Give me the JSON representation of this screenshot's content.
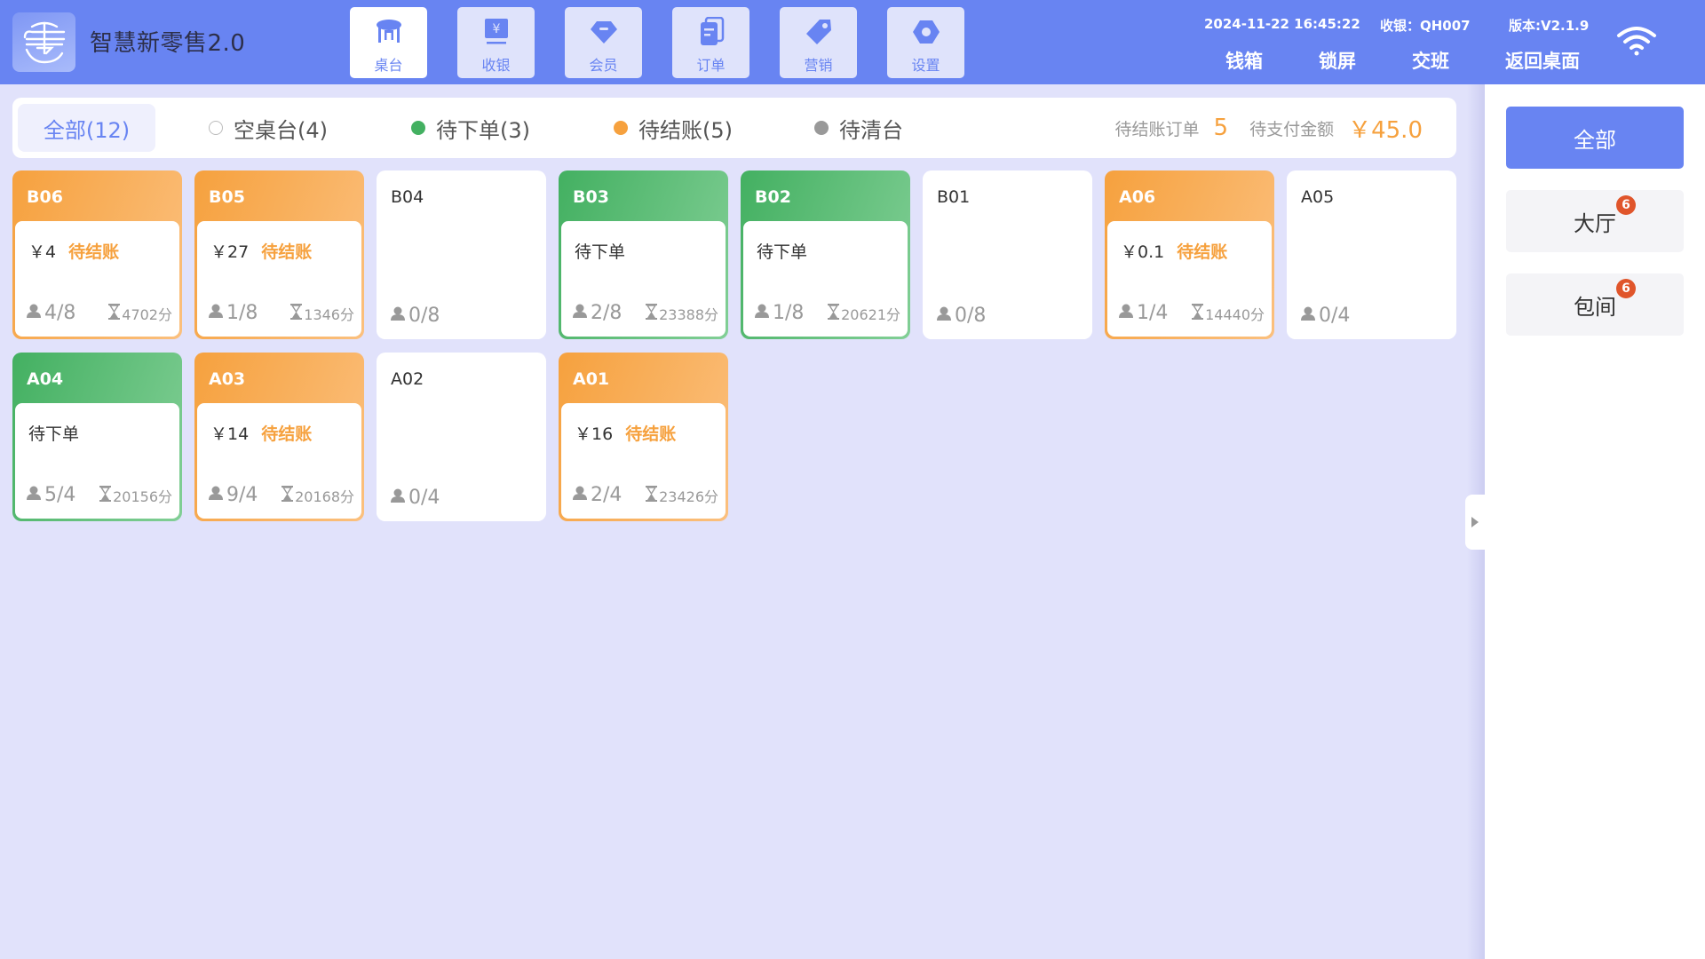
{
  "header": {
    "app_title": "智慧新零售2.0",
    "logo_icon": "store-logo-icon",
    "nav": [
      {
        "label": "桌台",
        "icon": "table-icon",
        "active": true
      },
      {
        "label": "收银",
        "icon": "cashier-icon",
        "active": false
      },
      {
        "label": "会员",
        "icon": "diamond-icon",
        "active": false
      },
      {
        "label": "订单",
        "icon": "order-icon",
        "active": false
      },
      {
        "label": "营销",
        "icon": "tag-icon",
        "active": false
      },
      {
        "label": "设置",
        "icon": "settings-icon",
        "active": false
      }
    ],
    "datetime": "2024-11-22 16:45:22",
    "cashier": "收银：QH007",
    "version": "版本:V2.1.9",
    "actions": [
      "钱箱",
      "锁屏",
      "交班",
      "返回桌面"
    ],
    "wifi_icon": "wifi-icon"
  },
  "filters": [
    {
      "label": "全部(12)",
      "active": true
    },
    {
      "label": "空桌台(4)",
      "dot_color": "#ffffff"
    },
    {
      "label": "待下单(3)",
      "dot_color": "#43b061"
    },
    {
      "label": "待结账(5)",
      "dot_color": "#f6a13e"
    },
    {
      "label": "待清台",
      "dot_color": "#999999"
    }
  ],
  "summary": {
    "pending_orders_label": "待结账订单",
    "pending_orders_value": "5",
    "pending_amount_label": "待支付金额",
    "pending_amount_value": "￥45.0"
  },
  "tables": [
    {
      "name": "B06",
      "status": "checkout",
      "amount": "￥4",
      "status_label": "待结账",
      "guests": "4/8",
      "time": "4702分"
    },
    {
      "name": "B05",
      "status": "checkout",
      "amount": "￥27",
      "status_label": "待结账",
      "guests": "1/8",
      "time": "1346分"
    },
    {
      "name": "B04",
      "status": "idle",
      "guests": "0/8"
    },
    {
      "name": "B03",
      "status": "order",
      "status_label": "待下单",
      "guests": "2/8",
      "time": "23388分"
    },
    {
      "name": "B02",
      "status": "order",
      "status_label": "待下单",
      "guests": "1/8",
      "time": "20621分"
    },
    {
      "name": "B01",
      "status": "idle",
      "guests": "0/8"
    },
    {
      "name": "A06",
      "status": "checkout",
      "amount": "￥0.1",
      "status_label": "待结账",
      "guests": "1/4",
      "time": "14440分"
    },
    {
      "name": "A05",
      "status": "idle",
      "guests": "0/4"
    },
    {
      "name": "A04",
      "status": "order",
      "status_label": "待下单",
      "guests": "5/4",
      "time": "20156分"
    },
    {
      "name": "A03",
      "status": "checkout",
      "amount": "￥14",
      "status_label": "待结账",
      "guests": "9/4",
      "time": "20168分"
    },
    {
      "name": "A02",
      "status": "idle",
      "guests": "0/4"
    },
    {
      "name": "A01",
      "status": "checkout",
      "amount": "￥16",
      "status_label": "待结账",
      "guests": "2/4",
      "time": "23426分"
    }
  ],
  "sidebar": {
    "areas": [
      {
        "label": "全部",
        "active": true
      },
      {
        "label": "大厅",
        "badge": "6"
      },
      {
        "label": "包间",
        "badge": "6"
      }
    ],
    "collapse_icon": "caret-right-icon"
  },
  "colors": {
    "primary": "#6884f2",
    "checkout": "#f6a13e",
    "order": "#43b061",
    "clear": "#999999",
    "badge": "#e0552b"
  }
}
